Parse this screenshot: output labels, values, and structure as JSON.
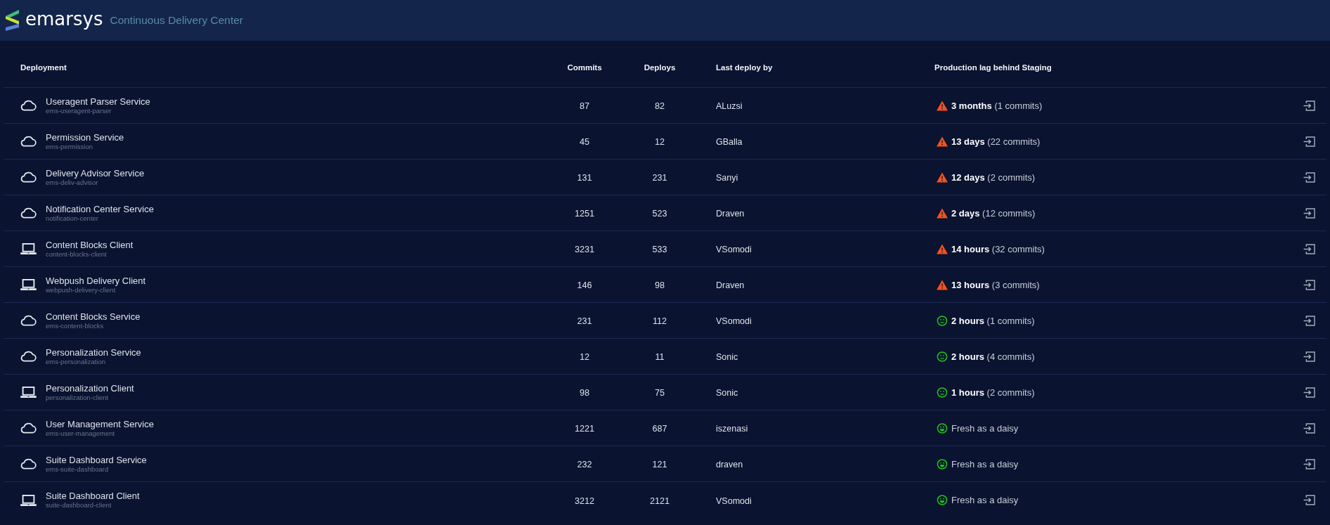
{
  "header": {
    "logo": "emarsys",
    "title": "Continuous Delivery Center"
  },
  "table": {
    "columns": [
      "Deployment",
      "Commits",
      "Deploys",
      "Last deploy by",
      "Production lag behind Staging"
    ],
    "rows": [
      {
        "kind": "service",
        "name": "Useragent Parser Service",
        "repo": "ems-useragent-parser",
        "commits": "87",
        "deploys": "82",
        "last_deploy_by": "ALuzsi",
        "lag": {
          "kind": "warning",
          "text": "**3 months** (1 commits)"
        }
      },
      {
        "kind": "service",
        "name": "Permission Service",
        "repo": "ems-permission",
        "commits": "45",
        "deploys": "12",
        "last_deploy_by": "GBalla",
        "lag": {
          "kind": "warning",
          "text": "**13 days** (22 commits)"
        }
      },
      {
        "kind": "service",
        "name": "Delivery Advisor Service",
        "repo": "ems-deliv-advisor",
        "commits": "131",
        "deploys": "231",
        "last_deploy_by": "Sanyi",
        "lag": {
          "kind": "warning",
          "text": "**12 days** (2 commits)"
        }
      },
      {
        "kind": "service",
        "name": "Notification Center Service",
        "repo": "notification-center",
        "commits": "1251",
        "deploys": "523",
        "last_deploy_by": "Draven",
        "lag": {
          "kind": "warning",
          "text": "**2 days** (12 commits)"
        }
      },
      {
        "kind": "client",
        "name": "Content Blocks Client",
        "repo": "content-blocks-client",
        "commits": "3231",
        "deploys": "533",
        "last_deploy_by": "VSomodi",
        "lag": {
          "kind": "warning",
          "text": "**14 hours** (32 commits)"
        }
      },
      {
        "kind": "client",
        "name": "Webpush Delivery Client",
        "repo": "webpush-delivery-client",
        "commits": "146",
        "deploys": "98",
        "last_deploy_by": "Draven",
        "lag": {
          "kind": "warning",
          "text": "**13 hours** (3 commits)"
        }
      },
      {
        "kind": "service",
        "name": "Content Blocks Service",
        "repo": "ems-content-blocks",
        "commits": "231",
        "deploys": "112",
        "last_deploy_by": "VSomodi",
        "lag": {
          "kind": "neutral",
          "text": "**2 hours** (1 commits)"
        }
      },
      {
        "kind": "service",
        "name": "Personalization Service",
        "repo": "ems-personalization",
        "commits": "12",
        "deploys": "11",
        "last_deploy_by": "Sonic",
        "lag": {
          "kind": "neutral",
          "text": "**2 hours** (4 commits)"
        }
      },
      {
        "kind": "client",
        "name": "Personalization Client",
        "repo": "personalization-client",
        "commits": "98",
        "deploys": "75",
        "last_deploy_by": "Sonic",
        "lag": {
          "kind": "neutral",
          "text": "**1 hours** (2 commits)"
        }
      },
      {
        "kind": "service",
        "name": "User Management Service",
        "repo": "ems-user-management",
        "commits": "1221",
        "deploys": "687",
        "last_deploy_by": "iszenasi",
        "lag": {
          "kind": "happy",
          "text": "Fresh as a daisy"
        }
      },
      {
        "kind": "service",
        "name": "Suite Dashboard Service",
        "repo": "ems-suite-dashboard",
        "commits": "232",
        "deploys": "121",
        "last_deploy_by": "draven",
        "lag": {
          "kind": "happy",
          "text": "Fresh as a daisy"
        }
      },
      {
        "kind": "client",
        "name": "Suite Dashboard Client",
        "repo": "suite-dashboard-client",
        "commits": "3212",
        "deploys": "2121",
        "last_deploy_by": "VSomodi",
        "lag": {
          "kind": "happy",
          "text": "Fresh as a daisy"
        }
      }
    ]
  }
}
